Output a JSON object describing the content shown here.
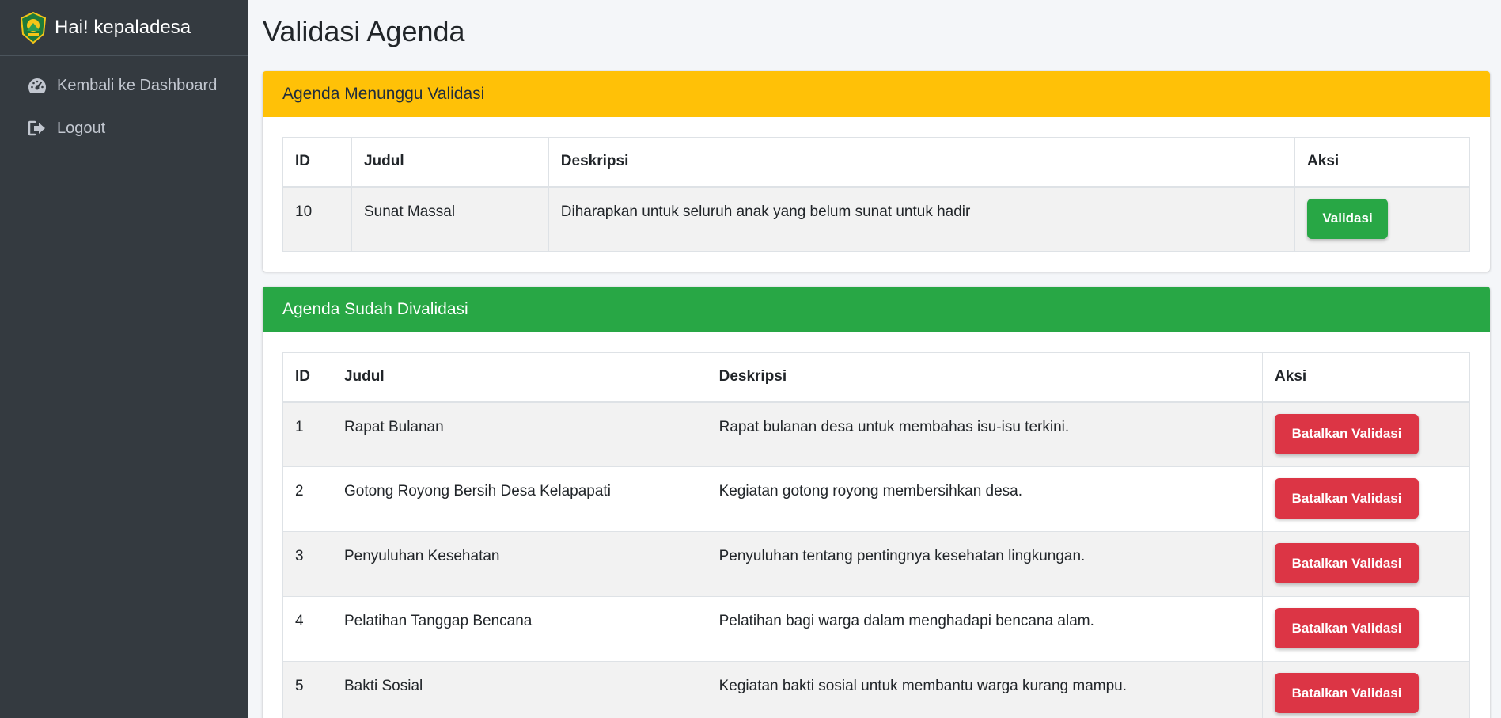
{
  "sidebar": {
    "brand_text": "Hai! kepaladesa",
    "items": [
      {
        "label": "Kembali ke Dashboard",
        "icon": "tachometer-icon"
      },
      {
        "label": "Logout",
        "icon": "sign-out-icon"
      }
    ]
  },
  "page": {
    "title": "Validasi Agenda"
  },
  "pending": {
    "header": "Agenda Menunggu Validasi",
    "columns": [
      "ID",
      "Judul",
      "Deskripsi",
      "Aksi"
    ],
    "rows": [
      {
        "id": "10",
        "judul": "Sunat Massal",
        "deskripsi": "Diharapkan untuk seluruh anak yang belum sunat untuk hadir",
        "action": "Validasi"
      }
    ]
  },
  "validated": {
    "header": "Agenda Sudah Divalidasi",
    "columns": [
      "ID",
      "Judul",
      "Deskripsi",
      "Aksi"
    ],
    "rows": [
      {
        "id": "1",
        "judul": "Rapat Bulanan",
        "deskripsi": "Rapat bulanan desa untuk membahas isu-isu terkini.",
        "action": "Batalkan Validasi"
      },
      {
        "id": "2",
        "judul": "Gotong Royong Bersih Desa Kelapapati",
        "deskripsi": "Kegiatan gotong royong membersihkan desa.",
        "action": "Batalkan Validasi"
      },
      {
        "id": "3",
        "judul": "Penyuluhan Kesehatan",
        "deskripsi": "Penyuluhan tentang pentingnya kesehatan lingkungan.",
        "action": "Batalkan Validasi"
      },
      {
        "id": "4",
        "judul": "Pelatihan Tanggap Bencana",
        "deskripsi": "Pelatihan bagi warga dalam menghadapi bencana alam.",
        "action": "Batalkan Validasi"
      },
      {
        "id": "5",
        "judul": "Bakti Sosial",
        "deskripsi": "Kegiatan bakti sosial untuk membantu warga kurang mampu.",
        "action": "Batalkan Validasi"
      }
    ]
  },
  "colors": {
    "sidebar_bg": "#343a40",
    "warning": "#ffc107",
    "success": "#28a745",
    "danger": "#dc3545"
  }
}
